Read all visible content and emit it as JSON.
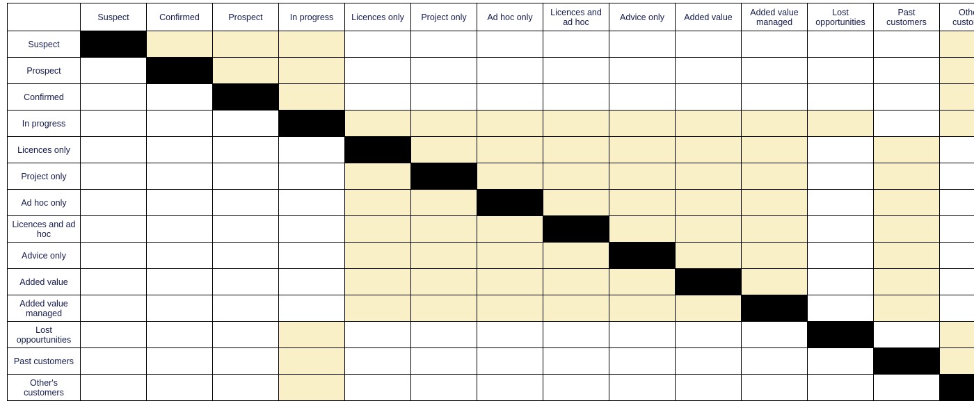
{
  "chart_data": {
    "type": "heatmap",
    "title": "",
    "row_categories": [
      "Suspect",
      "Prospect",
      "Confirmed",
      "In progress",
      "Licences only",
      "Project only",
      "Ad hoc only",
      "Licences and ad hoc",
      "Advice only",
      "Added value",
      "Added value managed",
      "Lost oppourtunities",
      "Past customers",
      "Other's customers"
    ],
    "col_categories": [
      "Suspect",
      "Confirmed",
      "Prospect",
      "In progress",
      "Licences only",
      "Project only",
      "Ad hoc only",
      "Licences and ad hoc",
      "Advice only",
      "Added value",
      "Added value managed",
      "Lost opportunities",
      "Past customers",
      "Other's customers"
    ],
    "value_legend": {
      "0": "white",
      "1": "highlight",
      "2": "black"
    },
    "values": [
      [
        2,
        1,
        1,
        1,
        0,
        0,
        0,
        0,
        0,
        0,
        0,
        0,
        0,
        1
      ],
      [
        0,
        2,
        1,
        1,
        0,
        0,
        0,
        0,
        0,
        0,
        0,
        0,
        0,
        1
      ],
      [
        0,
        0,
        2,
        1,
        0,
        0,
        0,
        0,
        0,
        0,
        0,
        0,
        0,
        1
      ],
      [
        0,
        0,
        0,
        2,
        1,
        1,
        1,
        1,
        1,
        1,
        1,
        1,
        0,
        1
      ],
      [
        0,
        0,
        0,
        0,
        2,
        1,
        1,
        1,
        1,
        1,
        1,
        0,
        1,
        0
      ],
      [
        0,
        0,
        0,
        0,
        1,
        2,
        1,
        1,
        1,
        1,
        1,
        0,
        1,
        0
      ],
      [
        0,
        0,
        0,
        0,
        1,
        1,
        2,
        1,
        1,
        1,
        1,
        0,
        1,
        0
      ],
      [
        0,
        0,
        0,
        0,
        1,
        1,
        1,
        2,
        1,
        1,
        1,
        0,
        1,
        0
      ],
      [
        0,
        0,
        0,
        0,
        1,
        1,
        1,
        1,
        2,
        1,
        1,
        0,
        1,
        0
      ],
      [
        0,
        0,
        0,
        0,
        1,
        1,
        1,
        1,
        1,
        2,
        1,
        0,
        1,
        0
      ],
      [
        0,
        0,
        0,
        0,
        1,
        1,
        1,
        1,
        1,
        1,
        2,
        0,
        1,
        0
      ],
      [
        0,
        0,
        0,
        1,
        0,
        0,
        0,
        0,
        0,
        0,
        0,
        2,
        0,
        1
      ],
      [
        0,
        0,
        0,
        1,
        0,
        0,
        0,
        0,
        0,
        0,
        0,
        0,
        2,
        1
      ],
      [
        0,
        0,
        0,
        1,
        0,
        0,
        0,
        0,
        0,
        0,
        0,
        0,
        0,
        2
      ]
    ]
  },
  "colors": {
    "black": "#000000",
    "highlight": "#faf0c8",
    "white": "#ffffff",
    "text": "#141b4d"
  }
}
